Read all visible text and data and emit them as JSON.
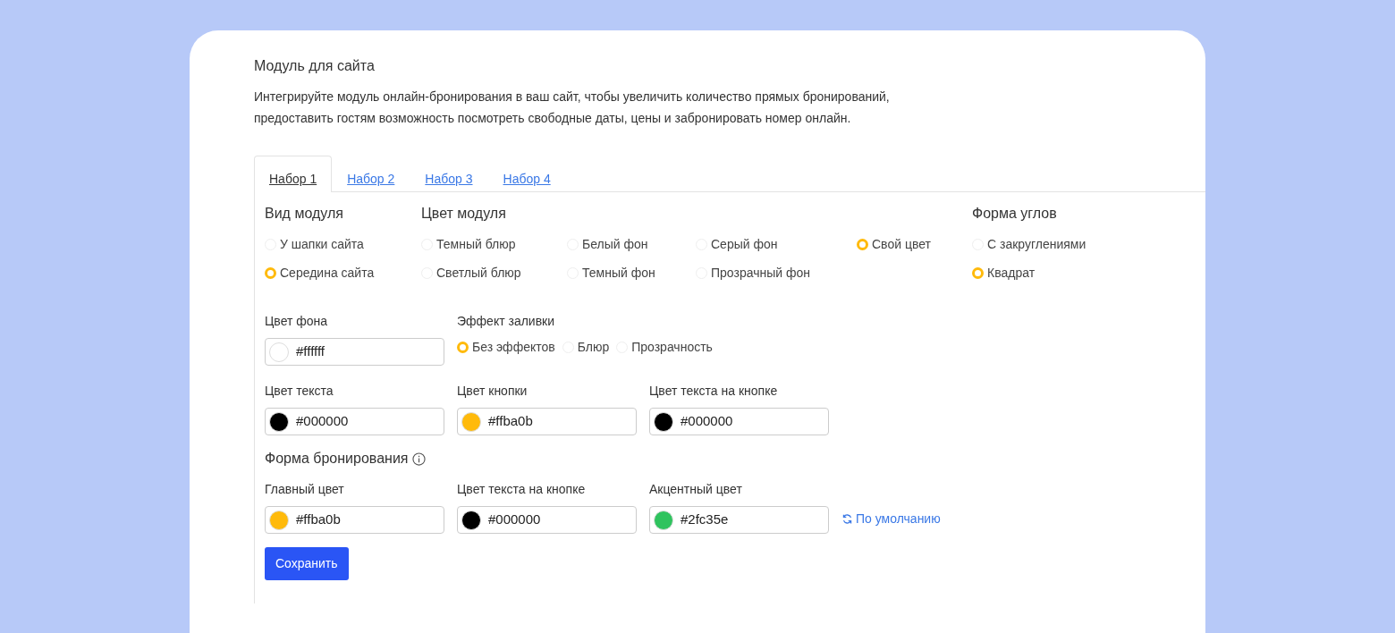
{
  "title": "Модуль для сайта",
  "description": "Интегрируйте модуль онлайн-бронирования в ваш сайт, чтобы увеличить количество прямых бронирований, предоставить гостям возможность посмотреть свободные даты, цены и забронировать номер онлайн.",
  "tabs": [
    {
      "label": "Набор 1",
      "selected": true
    },
    {
      "label": "Набор 2",
      "selected": false
    },
    {
      "label": "Набор 3",
      "selected": false
    },
    {
      "label": "Набор 4",
      "selected": false
    }
  ],
  "module_view": {
    "label": "Вид модуля",
    "options": [
      {
        "label": "У шапки сайта",
        "selected": false
      },
      {
        "label": "Середина сайта",
        "selected": true
      }
    ]
  },
  "module_color": {
    "label": "Цвет модуля",
    "options": [
      {
        "label": "Темный блюр",
        "selected": false
      },
      {
        "label": "Светлый блюр",
        "selected": false
      },
      {
        "label": "Белый фон",
        "selected": false
      },
      {
        "label": "Темный фон",
        "selected": false
      },
      {
        "label": "Серый фон",
        "selected": false
      },
      {
        "label": "Прозрачный фон",
        "selected": false
      },
      {
        "label": "Свой цвет",
        "selected": true
      }
    ]
  },
  "corner_shape": {
    "label": "Форма углов",
    "options": [
      {
        "label": "С закруглениями",
        "selected": false
      },
      {
        "label": "Квадрат",
        "selected": true
      }
    ]
  },
  "background_color": {
    "label": "Цвет фона",
    "value": "#ffffff"
  },
  "fill_effect": {
    "label": "Эффект заливки",
    "options": [
      {
        "label": "Без эффектов",
        "selected": true
      },
      {
        "label": "Блюр",
        "selected": false
      },
      {
        "label": "Прозрачность",
        "selected": false
      }
    ]
  },
  "colors": [
    {
      "label": "Цвет текста",
      "value": "#000000"
    },
    {
      "label": "Цвет кнопки",
      "value": "#ffba0b"
    },
    {
      "label": "Цвет текста на кнопке",
      "value": "#000000"
    }
  ],
  "booking_form": {
    "label": "Форма бронирования",
    "fields": [
      {
        "label": "Главный цвет",
        "value": "#ffba0b"
      },
      {
        "label": "Цвет текста на кнопке",
        "value": "#000000"
      },
      {
        "label": "Акцентный цвет",
        "value": "#2fc35e"
      }
    ]
  },
  "reset_link": "По умолчанию",
  "save_button": "Сохранить"
}
